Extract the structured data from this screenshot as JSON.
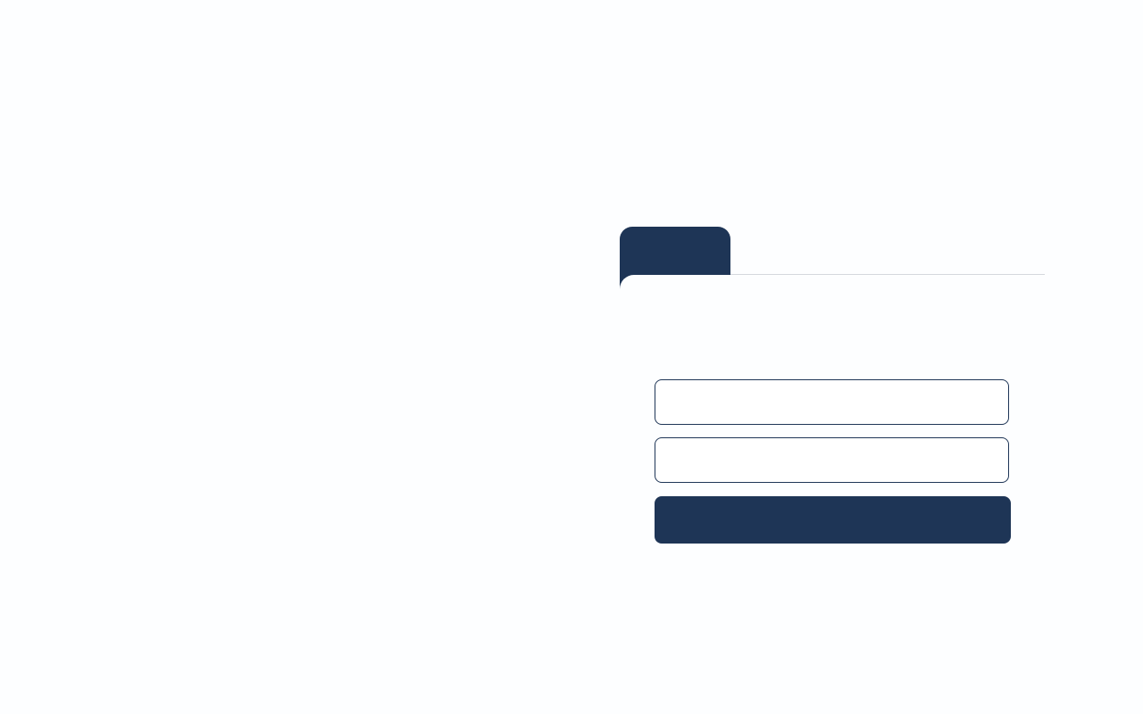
{
  "login": {
    "tab_label": "",
    "username": {
      "value": "",
      "placeholder": ""
    },
    "password": {
      "value": "",
      "placeholder": ""
    },
    "submit_label": ""
  },
  "colors": {
    "primary": "#1e3556",
    "background": "#fdfeff",
    "divider": "#d5d8dd"
  }
}
